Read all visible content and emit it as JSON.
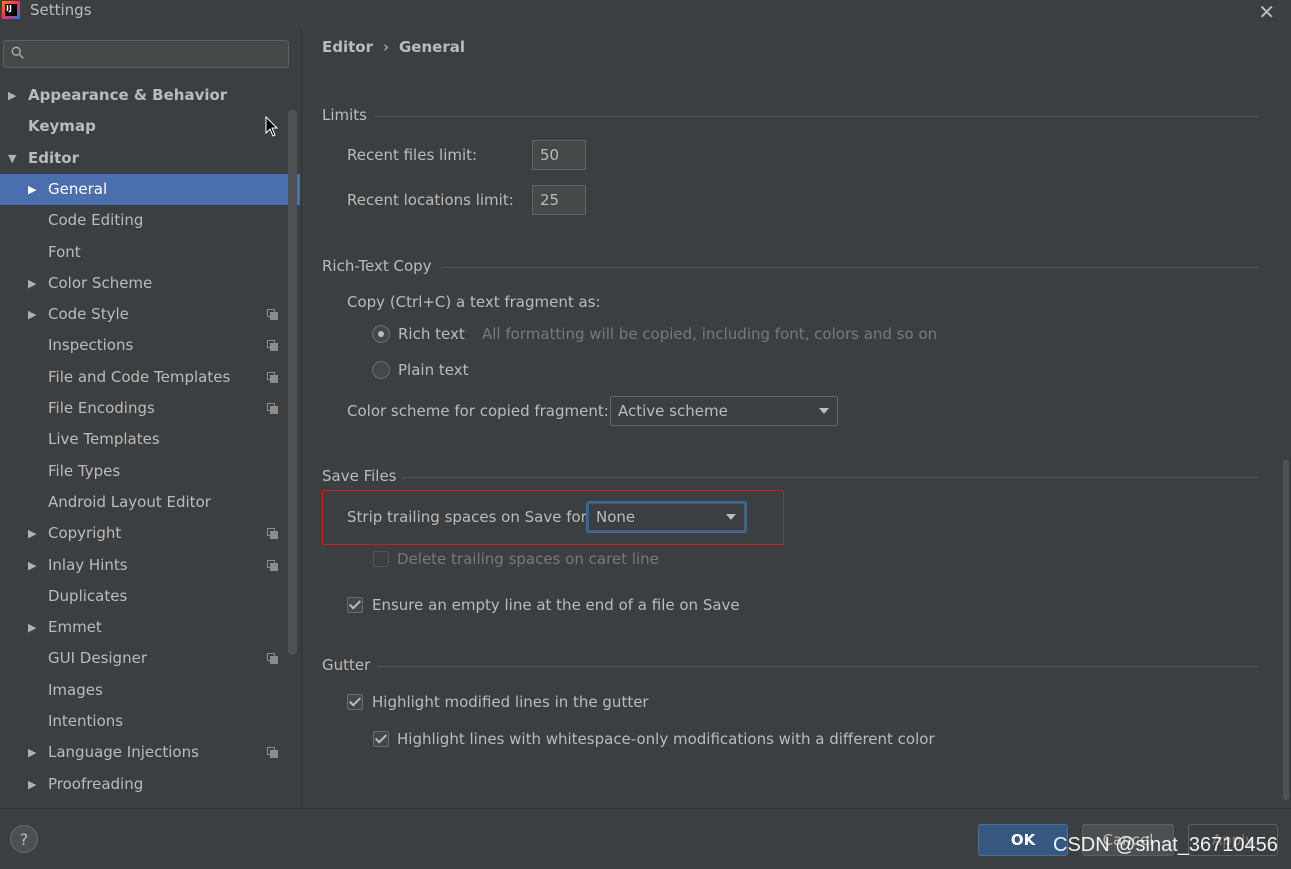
{
  "window": {
    "title": "Settings"
  },
  "sidebar": {
    "search_placeholder": "",
    "items": [
      {
        "label": "Appearance & Behavior",
        "level": 0,
        "arrow": "right",
        "bold": true
      },
      {
        "label": "Keymap",
        "level": 0,
        "arrow": "",
        "bold": true
      },
      {
        "label": "Editor",
        "level": 0,
        "arrow": "down",
        "bold": true
      },
      {
        "label": "General",
        "level": 1,
        "arrow": "right",
        "selected": true
      },
      {
        "label": "Code Editing",
        "level": 1,
        "arrow": ""
      },
      {
        "label": "Font",
        "level": 1,
        "arrow": ""
      },
      {
        "label": "Color Scheme",
        "level": 1,
        "arrow": "right"
      },
      {
        "label": "Code Style",
        "level": 1,
        "arrow": "right",
        "project": true
      },
      {
        "label": "Inspections",
        "level": 1,
        "arrow": "",
        "project": true
      },
      {
        "label": "File and Code Templates",
        "level": 1,
        "arrow": "",
        "project": true
      },
      {
        "label": "File Encodings",
        "level": 1,
        "arrow": "",
        "project": true
      },
      {
        "label": "Live Templates",
        "level": 1,
        "arrow": ""
      },
      {
        "label": "File Types",
        "level": 1,
        "arrow": ""
      },
      {
        "label": "Android Layout Editor",
        "level": 1,
        "arrow": ""
      },
      {
        "label": "Copyright",
        "level": 1,
        "arrow": "right",
        "project": true
      },
      {
        "label": "Inlay Hints",
        "level": 1,
        "arrow": "right",
        "project": true
      },
      {
        "label": "Duplicates",
        "level": 1,
        "arrow": ""
      },
      {
        "label": "Emmet",
        "level": 1,
        "arrow": "right"
      },
      {
        "label": "GUI Designer",
        "level": 1,
        "arrow": "",
        "project": true
      },
      {
        "label": "Images",
        "level": 1,
        "arrow": ""
      },
      {
        "label": "Intentions",
        "level": 1,
        "arrow": ""
      },
      {
        "label": "Language Injections",
        "level": 1,
        "arrow": "right",
        "project": true
      },
      {
        "label": "Proofreading",
        "level": 1,
        "arrow": "right"
      }
    ]
  },
  "breadcrumb": {
    "parent": "Editor",
    "separator": "›",
    "current": "General"
  },
  "limits": {
    "title": "Limits",
    "recent_files_label": "Recent files limit:",
    "recent_files_value": "50",
    "recent_locations_label": "Recent locations limit:",
    "recent_locations_value": "25"
  },
  "rich_text": {
    "title": "Rich-Text Copy",
    "copy_label": "Copy (Ctrl+C) a text fragment as:",
    "rich_label": "Rich text",
    "rich_hint": "All formatting will be copied, including font, colors and so on",
    "plain_label": "Plain text",
    "scheme_label": "Color scheme for copied fragment:",
    "scheme_value": "Active scheme"
  },
  "save_files": {
    "title": "Save Files",
    "strip_label": "Strip trailing spaces on Save for:",
    "strip_value": "None",
    "delete_caret_label": "Delete trailing spaces on caret line",
    "ensure_empty_label": "Ensure an empty line at the end of a file on Save"
  },
  "gutter": {
    "title": "Gutter",
    "highlight_modified_label": "Highlight modified lines in the gutter",
    "highlight_whitespace_label": "Highlight lines with whitespace-only modifications with a different color"
  },
  "footer": {
    "help_label": "?",
    "ok_label": "OK",
    "cancel_label": "Cancel",
    "apply_label": "Apply"
  },
  "watermark": "CSDN @sinat_36710456",
  "colors": {
    "background": "#3c3f41",
    "selection": "#4b6eaf",
    "highlight_box": "#d61a1a",
    "ok_button": "#365880"
  }
}
